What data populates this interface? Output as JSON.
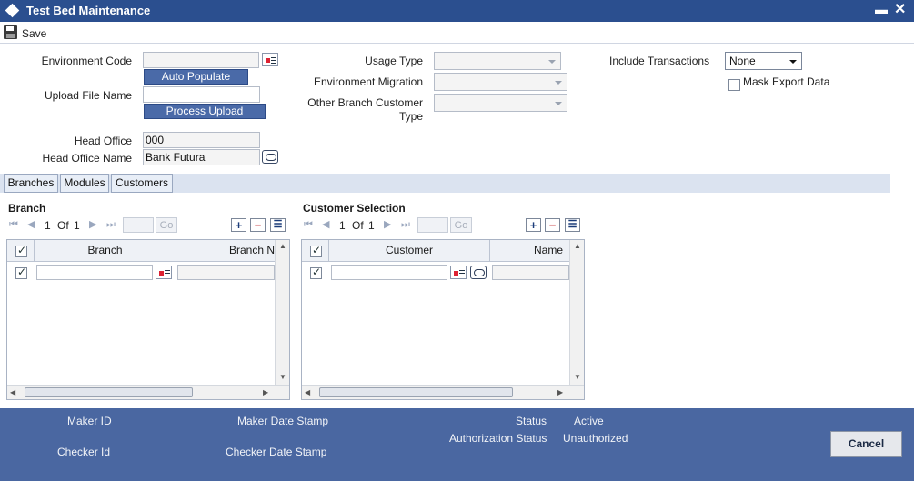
{
  "window": {
    "title": "Test Bed Maintenance",
    "minimize": "▬",
    "close": "✕"
  },
  "toolbar": {
    "save_label": "Save"
  },
  "form": {
    "environment_code_label": "Environment Code",
    "environment_code_value": "",
    "auto_populate_label": "Auto Populate",
    "upload_file_name_label": "Upload File Name",
    "upload_file_name_value": "",
    "process_upload_label": "Process Upload",
    "head_office_label": "Head Office",
    "head_office_value": "000",
    "head_office_name_label": "Head Office Name",
    "head_office_name_value": "Bank Futura",
    "usage_type_label": "Usage Type",
    "usage_type_value": "",
    "environment_migration_label": "Environment Migration",
    "environment_migration_value": "",
    "other_branch_customer_type_label_1": "Other Branch Customer",
    "other_branch_customer_type_label_2": "Type",
    "other_branch_customer_type_value": "",
    "include_transactions_label": "Include Transactions",
    "include_transactions_value": "None",
    "mask_export_data_label": "Mask Export Data",
    "mask_export_data_checked": false
  },
  "tabs": [
    {
      "label": "Branches"
    },
    {
      "label": "Modules"
    },
    {
      "label": "Customers"
    }
  ],
  "branch_panel": {
    "title": "Branch",
    "pager": {
      "current": "1",
      "of_label": "Of",
      "total": "1",
      "go_label": "Go"
    },
    "columns": [
      "Branch",
      "Branch N"
    ],
    "rows": [
      {
        "checked": true,
        "branch": ""
      }
    ]
  },
  "customer_panel": {
    "title": "Customer Selection",
    "pager": {
      "current": "1",
      "of_label": "Of",
      "total": "1",
      "go_label": "Go"
    },
    "columns": [
      "Customer",
      "Name"
    ],
    "rows": [
      {
        "checked": true,
        "customer": ""
      }
    ]
  },
  "footer": {
    "maker_id_label": "Maker ID",
    "maker_date_stamp_label": "Maker Date Stamp",
    "checker_id_label": "Checker Id",
    "checker_date_stamp_label": "Checker Date Stamp",
    "status_label": "Status",
    "status_value": "Active",
    "authorization_status_label": "Authorization Status",
    "authorization_status_value": "Unauthorized",
    "cancel_label": "Cancel"
  },
  "colors": {
    "titlebar": "#2b4f8f",
    "footer": "#4a67a1",
    "button_blue": "#4a6aa8"
  }
}
